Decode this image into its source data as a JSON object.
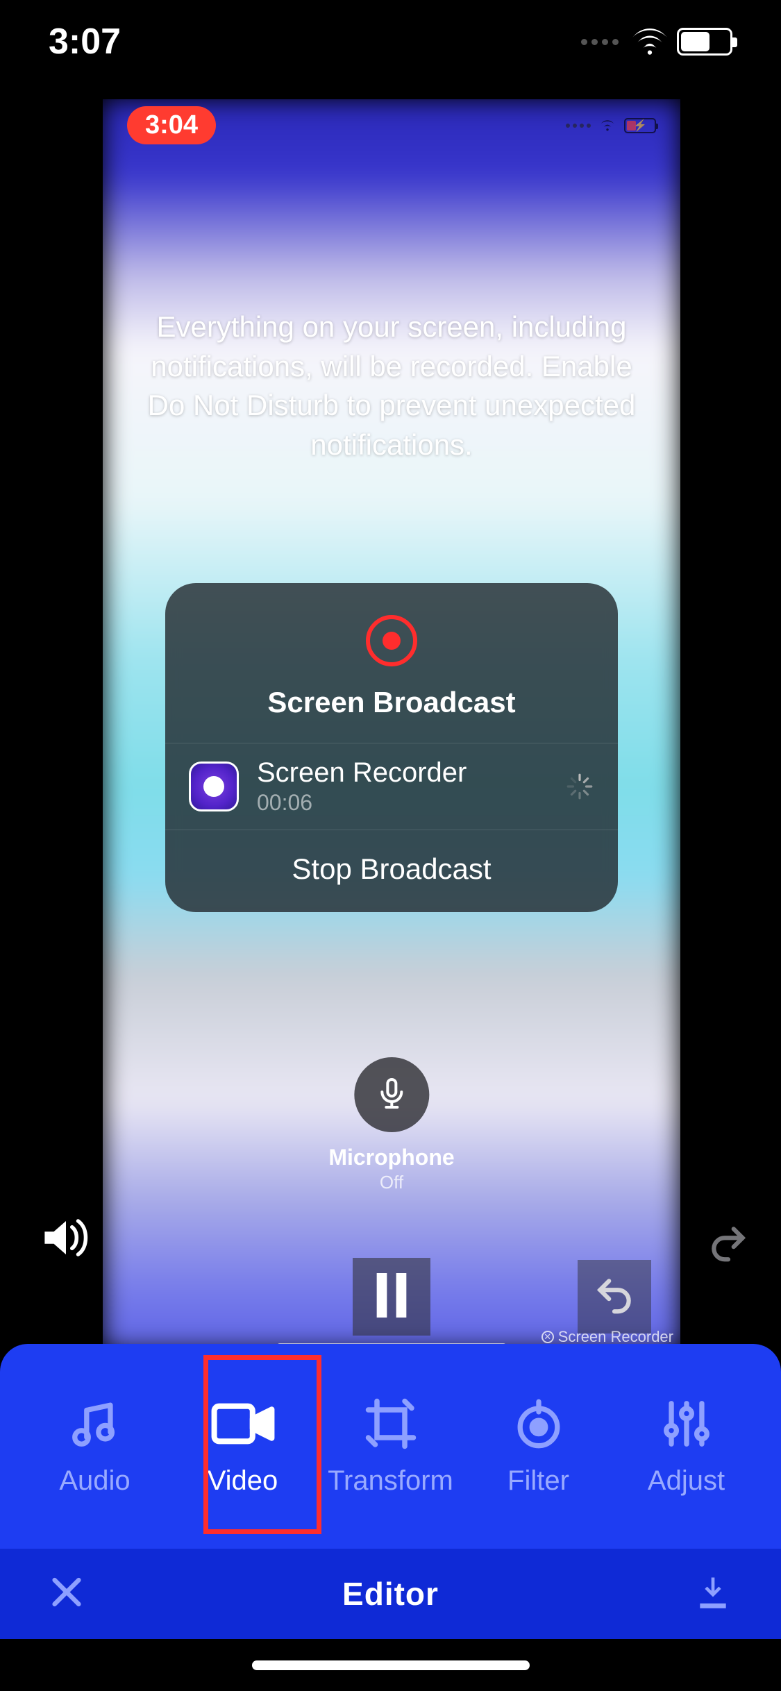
{
  "outer_status": {
    "time": "3:07"
  },
  "preview": {
    "inner_time": "3:04",
    "broadcast_info": "Everything on your screen, including notifications, will be recorded. Enable Do Not Disturb to prevent unexpected notifications.",
    "card": {
      "title": "Screen Broadcast",
      "app_name": "Screen Recorder",
      "elapsed": "00:06",
      "stop_label": "Stop Broadcast"
    },
    "microphone": {
      "label": "Microphone",
      "state": "Off"
    },
    "watermark": "Screen Recorder"
  },
  "editor": {
    "tools": {
      "audio": "Audio",
      "video": "Video",
      "transform": "Transform",
      "filter": "Filter",
      "adjust": "Adjust"
    },
    "title": "Editor"
  }
}
